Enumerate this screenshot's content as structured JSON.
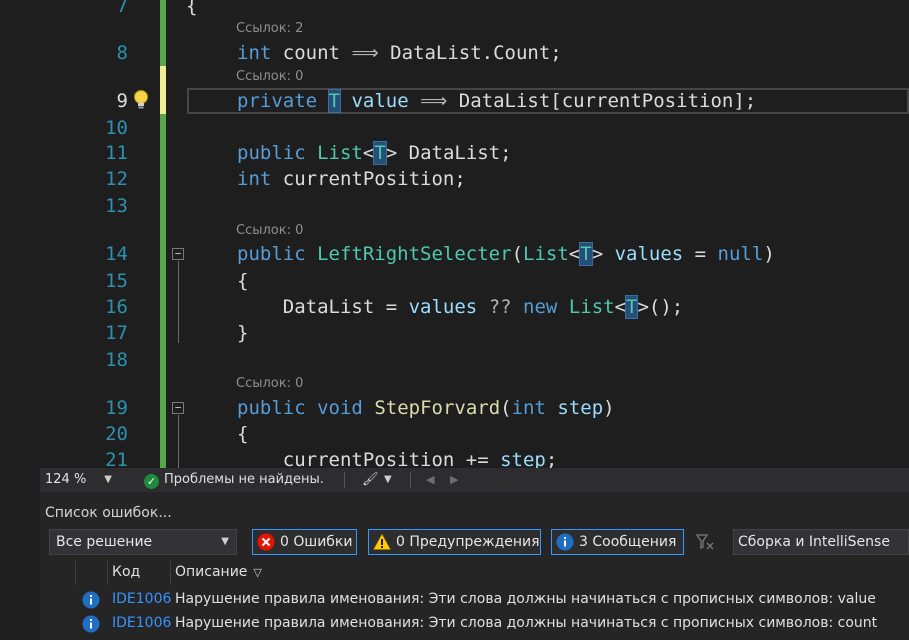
{
  "editor": {
    "active_line": 9,
    "line_numbers": [
      "7",
      "8",
      "9",
      "10",
      "11",
      "12",
      "13",
      "14",
      "15",
      "16",
      "17",
      "18",
      "19",
      "20",
      "21"
    ],
    "code_lens": [
      "Ссылок: 2",
      "Ссылок: 0",
      "Ссылок: 0",
      "Ссылок: 0"
    ],
    "lines": [
      {
        "n": "7",
        "tokens": [
          [
            "tx",
            "{"
          ]
        ]
      },
      {
        "n": "8",
        "tokens": [
          [
            "kw",
            "int"
          ],
          [
            "tx",
            " "
          ],
          [
            "tx",
            "count"
          ],
          [
            "tx",
            " "
          ],
          [
            "op",
            "⟹"
          ],
          [
            "tx",
            " DataList.Count;"
          ]
        ]
      },
      {
        "n": "9",
        "tokens": [
          [
            "kw",
            "private"
          ],
          [
            "tx",
            " "
          ],
          [
            "hl",
            "T"
          ],
          [
            "tx",
            " "
          ],
          [
            "pr",
            "value"
          ],
          [
            "tx",
            " "
          ],
          [
            "op",
            "⟹"
          ],
          [
            "tx",
            " DataList[currentPosition];"
          ]
        ]
      },
      {
        "n": "10",
        "tokens": []
      },
      {
        "n": "11",
        "tokens": [
          [
            "kw",
            "public"
          ],
          [
            "tx",
            " "
          ],
          [
            "ty",
            "List"
          ],
          [
            "tx",
            "<"
          ],
          [
            "hl",
            "T"
          ],
          [
            "tx",
            "> DataList;"
          ]
        ]
      },
      {
        "n": "12",
        "tokens": [
          [
            "kw",
            "int"
          ],
          [
            "tx",
            " currentPosition;"
          ]
        ]
      },
      {
        "n": "13",
        "tokens": []
      },
      {
        "n": "14",
        "tokens": [
          [
            "kw",
            "public"
          ],
          [
            "tx",
            " "
          ],
          [
            "ty",
            "LeftRightSelecter"
          ],
          [
            "tx",
            "("
          ],
          [
            "ty",
            "List"
          ],
          [
            "tx",
            "<"
          ],
          [
            "hl",
            "T"
          ],
          [
            "tx",
            "> "
          ],
          [
            "pr",
            "values"
          ],
          [
            "tx",
            " = "
          ],
          [
            "kw",
            "null"
          ],
          [
            "tx",
            ")"
          ]
        ]
      },
      {
        "n": "15",
        "tokens": [
          [
            "tx",
            "{"
          ]
        ]
      },
      {
        "n": "16",
        "tokens": [
          [
            "tx",
            "    DataList = "
          ],
          [
            "pr",
            "values"
          ],
          [
            "tx",
            " "
          ],
          [
            "op",
            "??"
          ],
          [
            "tx",
            " "
          ],
          [
            "kw",
            "new"
          ],
          [
            "tx",
            " "
          ],
          [
            "ty",
            "List"
          ],
          [
            "tx",
            "<"
          ],
          [
            "hl",
            "T"
          ],
          [
            "tx",
            ">();"
          ]
        ]
      },
      {
        "n": "17",
        "tokens": [
          [
            "tx",
            "}"
          ]
        ]
      },
      {
        "n": "18",
        "tokens": []
      },
      {
        "n": "19",
        "tokens": [
          [
            "kw",
            "public"
          ],
          [
            "tx",
            " "
          ],
          [
            "kw",
            "void"
          ],
          [
            "tx",
            " "
          ],
          [
            "fn",
            "StepForvard"
          ],
          [
            "tx",
            "("
          ],
          [
            "kw",
            "int"
          ],
          [
            "tx",
            " "
          ],
          [
            "pr",
            "step"
          ],
          [
            "tx",
            ")"
          ]
        ]
      },
      {
        "n": "20",
        "tokens": [
          [
            "tx",
            "{"
          ]
        ]
      },
      {
        "n": "21",
        "tokens": [
          [
            "tx",
            "    currentPosition += "
          ],
          [
            "pr",
            "step"
          ],
          [
            "tx",
            ";"
          ]
        ]
      }
    ]
  },
  "status": {
    "zoom": "124 %",
    "problems": "Проблемы не найдены."
  },
  "error_list": {
    "title": "Список ошибок...",
    "scope": "Все решение",
    "errors_label": "0 Ошибки",
    "warnings_label": "0 Предупреждения",
    "messages_label": "3 Сообщения",
    "source": "Сборка и IntelliSense",
    "columns": {
      "code": "Код",
      "description": "Описание"
    },
    "rows": [
      {
        "code": "IDE1006",
        "description": "Нарушение правила именования: Эти слова должны начинаться с прописных символов: value"
      },
      {
        "code": "IDE1006",
        "description": "Нарушение правила именования: Эти слова должны начинаться с прописных символов: count"
      }
    ]
  },
  "colors": {
    "keyword": "#569cd6",
    "type": "#4ec9b0",
    "method": "#dcdcaa",
    "parameter": "#9cdcfe",
    "line_number": "#2b91af",
    "changed_bar": "#57a64a",
    "info_icon": "#1e6fc4",
    "error_icon": "#e51400"
  }
}
